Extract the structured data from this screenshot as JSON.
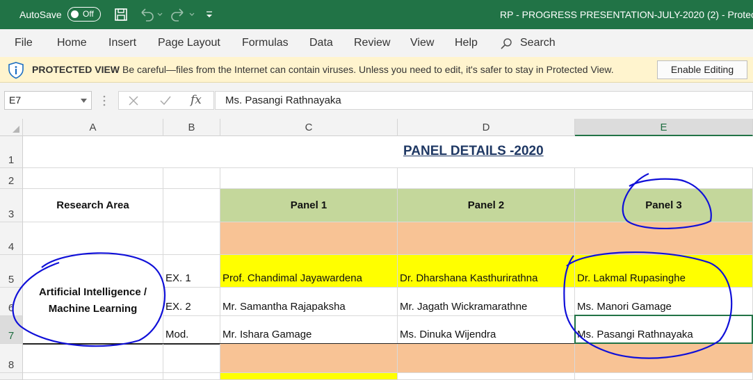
{
  "titlebar": {
    "autosave_label": "AutoSave",
    "autosave_state": "Off",
    "window_title": "RP - PROGRESS PRESENTATION-JULY-2020 (2)  -  Protec"
  },
  "menu": [
    "File",
    "Home",
    "Insert",
    "Page Layout",
    "Formulas",
    "Data",
    "Review",
    "View",
    "Help"
  ],
  "search_label": "Search",
  "protected_view": {
    "title": "PROTECTED VIEW",
    "message": "Be careful—files from the Internet can contain viruses. Unless you need to edit, it's safer to stay in Protected View.",
    "button": "Enable Editing"
  },
  "formula_bar": {
    "name_box": "E7",
    "fx_label": "fx",
    "value": "Ms. Pasangi Rathnayaka"
  },
  "columns": [
    "A",
    "B",
    "C",
    "D",
    "E"
  ],
  "rows": [
    "1",
    "2",
    "3",
    "4",
    "5",
    "6",
    "7",
    "8"
  ],
  "sheet": {
    "title": "PANEL DETAILS -2020",
    "research_area_header": "Research Area",
    "panel_headers": [
      "Panel 1",
      "Panel 2",
      "Panel 3"
    ],
    "research_area": "Artificial Intelligence / Machine Learning",
    "roles": [
      "EX. 1",
      "EX. 2",
      "Mod."
    ],
    "members": [
      [
        "Prof. Chandimal Jayawardena",
        "Dr. Dharshana Kasthurirathna",
        "Dr. Lakmal Rupasinghe"
      ],
      [
        "Mr. Samantha Rajapaksha",
        "Mr. Jagath Wickramarathne",
        "Ms. Manori Gamage"
      ],
      [
        "Mr. Ishara Gamage",
        "Ms. Dinuka Wijendra",
        "Ms. Pasangi Rathnayaka"
      ]
    ]
  },
  "colors": {
    "title_bar": "#217346",
    "protected_bar": "#fff4ce",
    "panel_header": "#c4d79b",
    "separator_row": "#f8c395",
    "examiner_1_row": "#ffff00",
    "annotation_ink": "#1010d8"
  }
}
